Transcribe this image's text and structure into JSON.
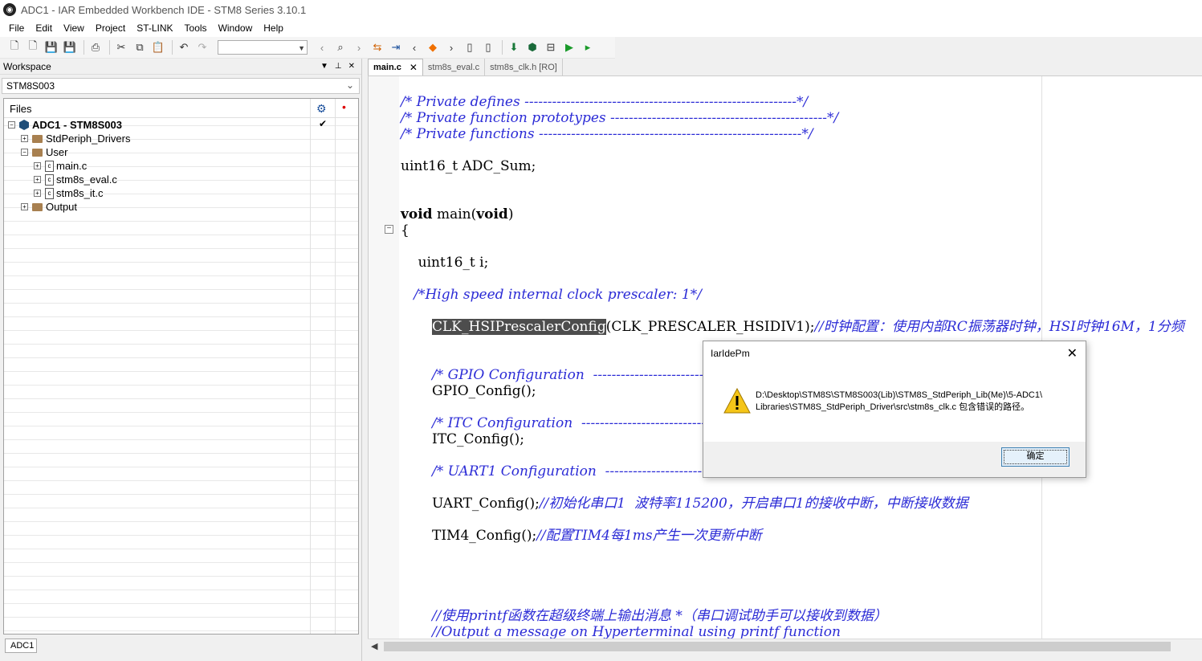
{
  "window": {
    "title": "ADC1 - IAR Embedded Workbench IDE - STM8 Series 3.10.1"
  },
  "menu": [
    "File",
    "Edit",
    "View",
    "Project",
    "ST-LINK",
    "Tools",
    "Window",
    "Help"
  ],
  "workspace": {
    "title": "Workspace",
    "configuration": "STM8S003",
    "files_header": "Files",
    "tree": [
      {
        "label": "ADC1 - STM8S003",
        "checked": "✔"
      },
      {
        "label": "StdPeriph_Drivers"
      },
      {
        "label": "User"
      },
      {
        "label": "main.c"
      },
      {
        "label": "stm8s_eval.c"
      },
      {
        "label": "stm8s_it.c"
      },
      {
        "label": "Output"
      }
    ],
    "bottom_tab": "ADC1"
  },
  "editor": {
    "tabs": [
      {
        "label": "main.c",
        "close": "✕"
      },
      {
        "label": "stm8s_eval.c"
      },
      {
        "label": "stm8s_clk.h [RO]"
      }
    ],
    "lines": {
      "l1": "/* Private defines -----------------------------------------------------------*/",
      "l2": "/* Private function prototypes -----------------------------------------------*/",
      "l3": "/* Private functions ---------------------------------------------------------*/",
      "l4": "uint16_t ADC_Sum;",
      "l5a": "void",
      "l5b": " main(",
      "l5c": "void",
      "l5d": ")",
      "l6": "{",
      "l7": "    uint16_t i;",
      "l8": "   /*High speed internal clock prescaler: 1*/",
      "l9a": "CLK_HSIPrescalerConfig",
      "l9b": "(CLK_PRESCALER_HSIDIV1);",
      "l9c": "//时钟配置：使用内部RC振荡器时钟，HSI时钟16M，1分频",
      "l10": "/* GPIO Configuration  ------------------------------------------*/",
      "l11": "GPIO_Config();",
      "l12": "/* ITC Configuration  -------------------------------------------*/",
      "l13": "ITC_Config();",
      "l14": "/* UART1 Configuration  ----------------------------------------*/",
      "l15a": "UART_Config();",
      "l15b": "//初始化串口1  波特率115200，开启串口1的接收中断，中断接收数据",
      "l16a": "TIM4_Config();",
      "l16b": "//配置TIM4每1ms产生一次更新中断",
      "l17": "//使用printf函数在超级终端上输出消息 *（串口调试助手可以接收到数据）",
      "l18": "//Output a message on Hyperterminal using printf function"
    }
  },
  "dialog": {
    "title": "IarIdePm",
    "close": "✕",
    "message_line1": "D:\\Desktop\\STM8S\\STM8S003(Lib)\\STM8S_StdPeriph_Lib(Me)\\5-ADC1\\",
    "message_line2": "Libraries\\STM8S_StdPeriph_Driver\\src\\stm8s_clk.c 包含错误的路径。",
    "ok": "确定"
  }
}
